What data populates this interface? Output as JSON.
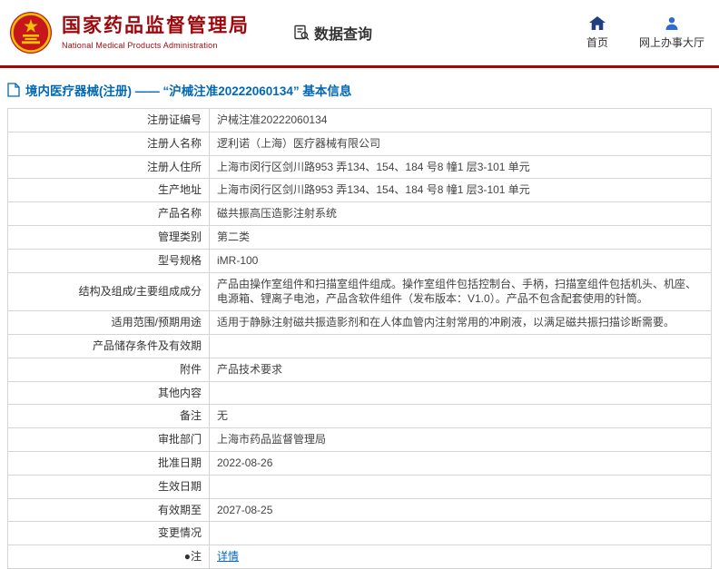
{
  "header": {
    "org_name": "国家药品监督管理局",
    "org_name_en": "National Medical Products Administration",
    "data_query_label": "数据查询",
    "nav_home_label": "首页",
    "nav_hall_label": "网上办事大厅"
  },
  "page": {
    "title": "境内医疗器械(注册) —— “沪械注准20222060134” 基本信息"
  },
  "colors": {
    "brand_red": "#9e070c",
    "title_blue": "#0068b7",
    "link_blue": "#0066cc",
    "table_border": "#d4d4d4"
  },
  "icons": {
    "logo": "national-emblem",
    "data_query": "document-magnifier-icon",
    "home": "home-icon",
    "hall": "person-icon",
    "page_title": "document-icon"
  },
  "table": {
    "rows": [
      {
        "label": "注册证编号",
        "value": "沪械注准20222060134"
      },
      {
        "label": "注册人名称",
        "value": "逻利诺（上海）医疗器械有限公司"
      },
      {
        "label": "注册人住所",
        "value": "上海市闵行区剑川路953 弄134、154、184 号8 幢1 层3-101 单元"
      },
      {
        "label": "生产地址",
        "value": "上海市闵行区剑川路953 弄134、154、184 号8 幢1 层3-101 单元"
      },
      {
        "label": "产品名称",
        "value": "磁共振高压造影注射系统"
      },
      {
        "label": "管理类别",
        "value": "第二类"
      },
      {
        "label": "型号规格",
        "value": "iMR-100"
      },
      {
        "label": "结构及组成/主要组成成分",
        "value": "产品由操作室组件和扫描室组件组成。操作室组件包括控制台、手柄，扫描室组件包括机头、机座、电源箱、锂离子电池，产品含软件组件（发布版本：V1.0）。产品不包含配套使用的针筒。"
      },
      {
        "label": "适用范围/预期用途",
        "value": "适用于静脉注射磁共振造影剂和在人体血管内注射常用的冲刷液，以满足磁共振扫描诊断需要。"
      },
      {
        "label": "产品储存条件及有效期",
        "value": ""
      },
      {
        "label": "附件",
        "value": "产品技术要求"
      },
      {
        "label": "其他内容",
        "value": ""
      },
      {
        "label": "备注",
        "value": "无"
      },
      {
        "label": "审批部门",
        "value": "上海市药品监督管理局"
      },
      {
        "label": "批准日期",
        "value": "2022-08-26"
      },
      {
        "label": "生效日期",
        "value": ""
      },
      {
        "label": "有效期至",
        "value": "2027-08-25"
      },
      {
        "label": "变更情况",
        "value": ""
      },
      {
        "label": "●注",
        "value": "详情",
        "link": true
      }
    ]
  }
}
